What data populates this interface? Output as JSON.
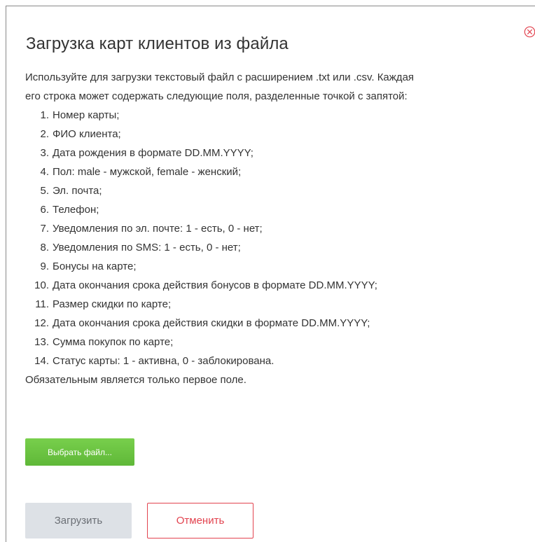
{
  "dialog": {
    "title": "Загрузка карт клиентов из файла",
    "intro_line1": "Используйте для загрузки текстовый файл с расширением .txt или .csv. Каждая",
    "intro_line2": "его строка может содержать следующие поля, разделенные точкой с запятой:",
    "fields": [
      {
        "num": "1.",
        "text": "Номер карты;"
      },
      {
        "num": "2.",
        "text": "ФИО клиента;"
      },
      {
        "num": "3.",
        "text": "Дата рождения в формате DD.MM.YYYY;"
      },
      {
        "num": "4.",
        "text": "Пол: male - мужской, female - женский;"
      },
      {
        "num": "5.",
        "text": "Эл. почта;"
      },
      {
        "num": "6.",
        "text": "Телефон;"
      },
      {
        "num": "7.",
        "text": "Уведомления по эл. почте: 1 - есть, 0 - нет;"
      },
      {
        "num": "8.",
        "text": "Уведомления по SMS: 1 - есть, 0 - нет;"
      },
      {
        "num": "9.",
        "text": "Бонусы на карте;"
      },
      {
        "num": "10.",
        "text": "Дата окончания срока действия бонусов в формате DD.MM.YYYY;"
      },
      {
        "num": "11.",
        "text": "Размер скидки по карте;"
      },
      {
        "num": "12.",
        "text": "Дата окончания срока действия скидки в формате DD.MM.YYYY;"
      },
      {
        "num": "13.",
        "text": "Сумма покупок по карте;"
      },
      {
        "num": "14.",
        "text": "Статус карты: 1 - активна, 0 - заблокирована."
      }
    ],
    "required_note": "Обязательным является только первое поле.",
    "choose_file_label": "Выбрать файл...",
    "upload_label": "Загрузить",
    "cancel_label": "Отменить",
    "close_icon": "close-circle-icon"
  },
  "colors": {
    "accent_green": "#6cc644",
    "danger_red": "#e2434f",
    "disabled_gray": "#dde1e6",
    "text": "#333333"
  }
}
